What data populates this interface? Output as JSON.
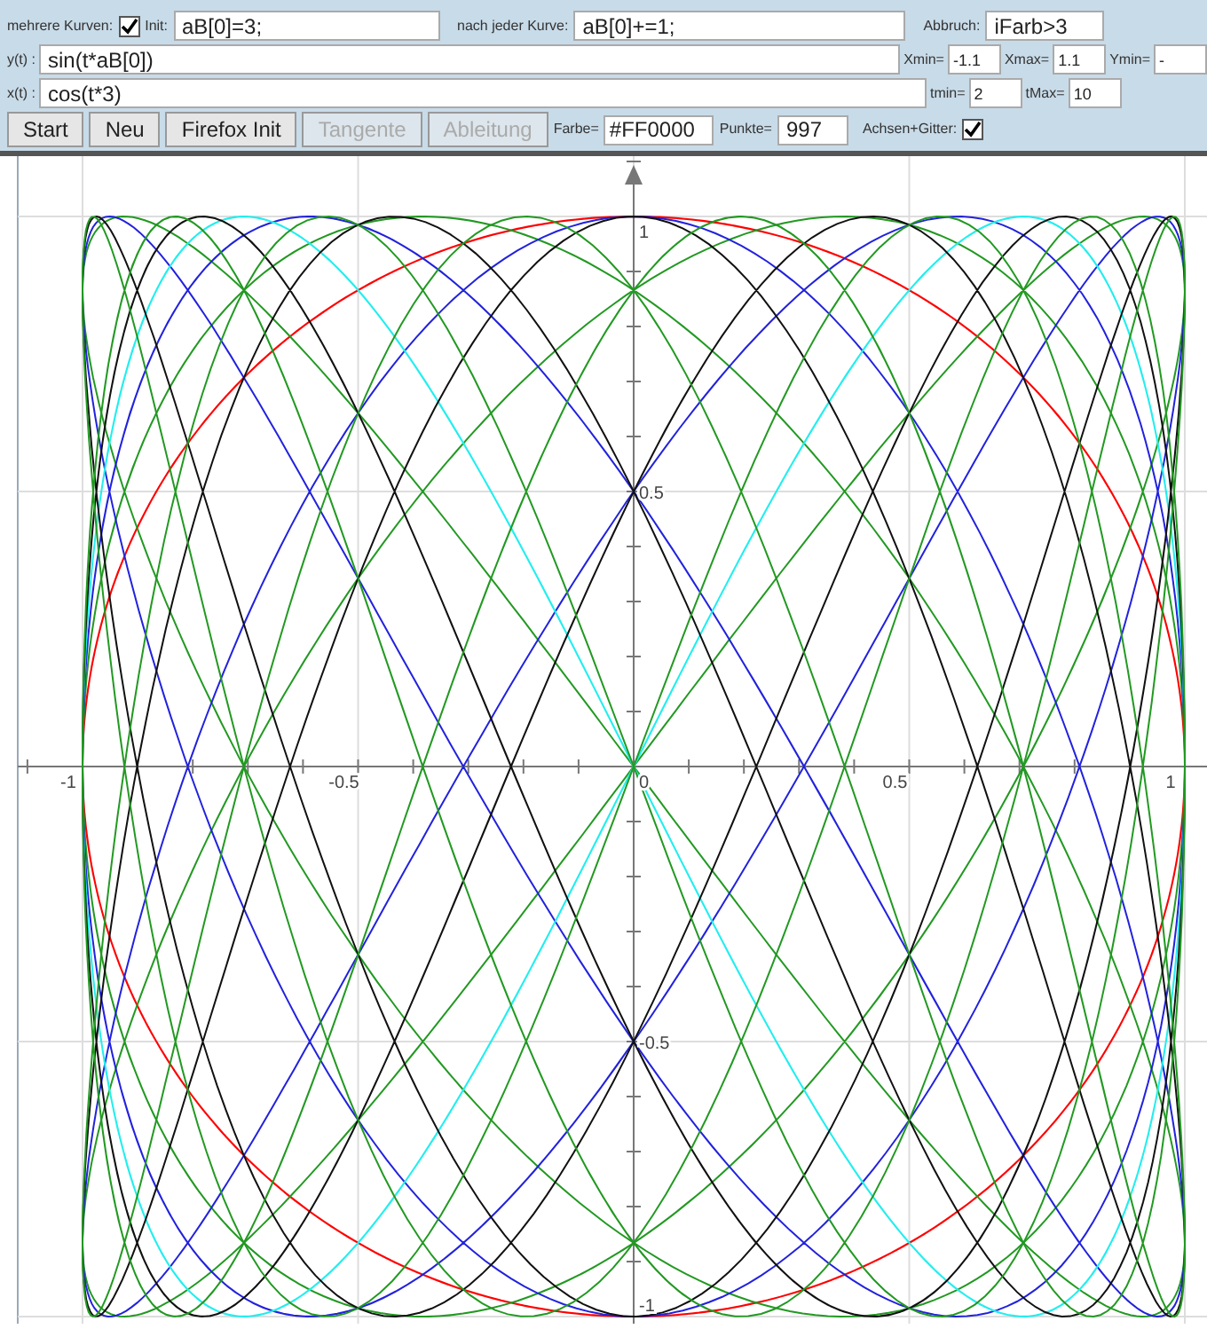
{
  "options": {
    "multi_label": "mehrere Kurven:",
    "multi_checked": true,
    "init_label": "Init:",
    "init_value": "aB[0]=3;",
    "after_label": "nach jeder Kurve:",
    "after_value": "aB[0]+=1;",
    "stop_label": "Abbruch:",
    "stop_value": "iFarb>3"
  },
  "y_row": {
    "label": "y(t) :",
    "value": "sin(t*aB[0])",
    "params": [
      {
        "label": "Xmin=",
        "value": "-1.1"
      },
      {
        "label": "Xmax=",
        "value": "1.1"
      },
      {
        "label": "Ymin=",
        "value": "-"
      }
    ]
  },
  "x_row": {
    "label": "x(t) :",
    "value": "cos(t*3)",
    "params": [
      {
        "label": "tmin=",
        "value": "2"
      },
      {
        "label": "tMax=",
        "value": "10"
      }
    ]
  },
  "buttons": [
    {
      "label": "Start",
      "disabled": false
    },
    {
      "label": "Neu",
      "disabled": false
    },
    {
      "label": "Firefox Init",
      "disabled": false
    },
    {
      "label": "Tangente",
      "disabled": true
    },
    {
      "label": "Ableitung",
      "disabled": true
    }
  ],
  "color_label": "Farbe=",
  "color_value": "#FF0000",
  "points_label": "Punkte=",
  "points_value": "997",
  "axes_label": "Achsen+Gitter:",
  "axes_checked": true,
  "plot": {
    "x_labels": [
      "-1",
      "-0.5",
      "0",
      "0.5",
      "1"
    ],
    "y_labels": [
      "1",
      "0.5",
      "-0.5",
      "-1"
    ]
  }
}
